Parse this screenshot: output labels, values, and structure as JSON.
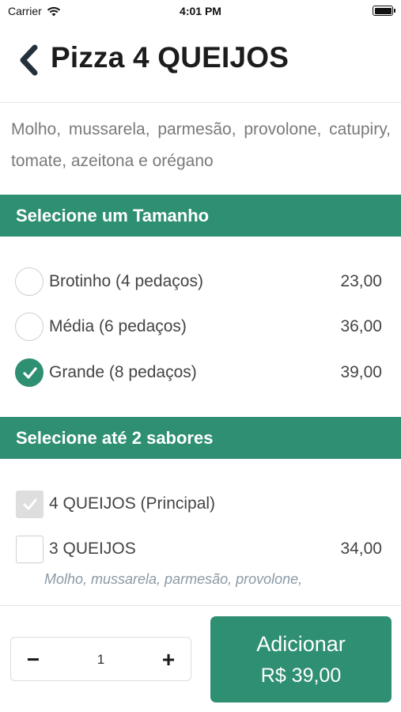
{
  "status_bar": {
    "carrier": "Carrier",
    "time": "4:01 PM"
  },
  "header": {
    "title": "Pizza 4 QUEIJOS"
  },
  "description": "Molho, mussarela, parmesão, provolone, catupiry, tomate, azeitona e orégano",
  "sizes": {
    "title": "Selecione um Tamanho",
    "options": [
      {
        "label": "Brotinho (4 pedaços)",
        "price": "23,00",
        "selected": false
      },
      {
        "label": "Média (6 pedaços)",
        "price": "36,00",
        "selected": false
      },
      {
        "label": "Grande (8 pedaços)",
        "price": "39,00",
        "selected": true
      }
    ]
  },
  "flavors": {
    "title": "Selecione até 2 sabores",
    "options": [
      {
        "label": "4 QUEIJOS (Principal)",
        "price": "",
        "checked": true,
        "disabled": true
      },
      {
        "label": "3 QUEIJOS",
        "price": "34,00",
        "checked": false,
        "disabled": false,
        "description": "Molho, mussarela, parmesão, provolone,"
      }
    ]
  },
  "footer": {
    "minus_label": "−",
    "quantity": "1",
    "plus_label": "+",
    "add_label": "Adicionar",
    "add_price": "R$ 39,00"
  },
  "colors": {
    "accent": "#2f8f73",
    "muted_text": "#7a7a7a"
  }
}
